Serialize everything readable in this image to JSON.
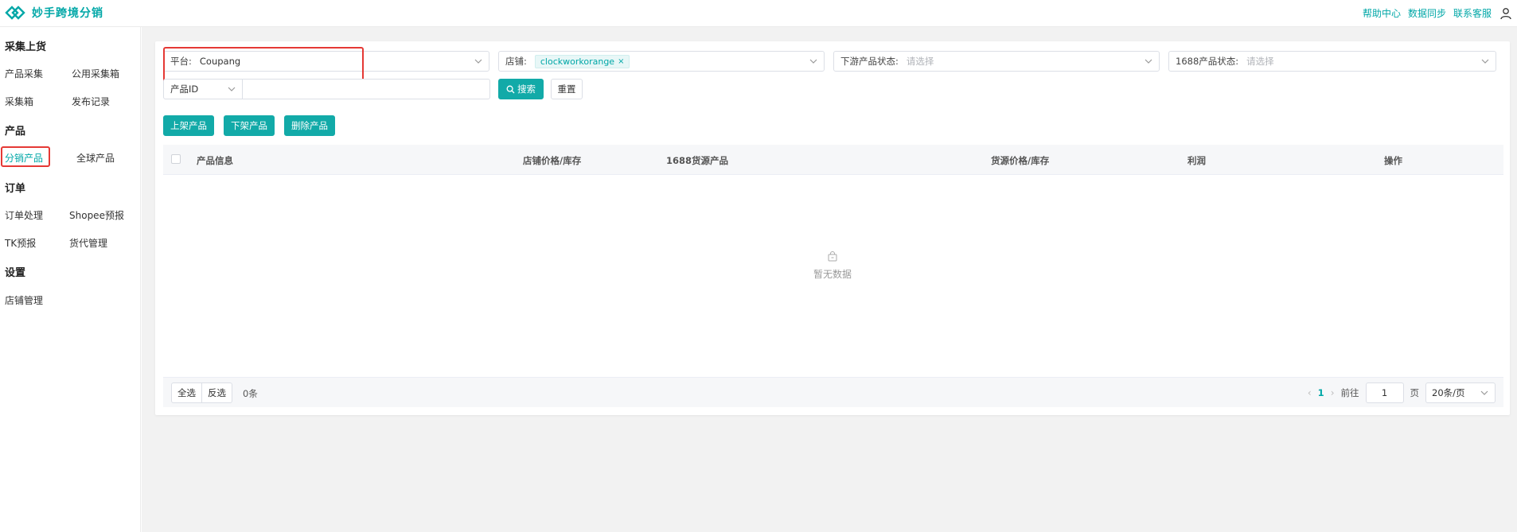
{
  "header": {
    "app_name": "妙手跨境分销",
    "links": [
      "帮助中心",
      "数据同步",
      "联系客服"
    ]
  },
  "sidebar": {
    "sections": [
      {
        "title": "采集上货",
        "items": [
          "产品采集",
          "公用采集箱",
          "采集箱",
          "发布记录"
        ]
      },
      {
        "title": "产品",
        "items": [
          "分销产品",
          "全球产品"
        ]
      },
      {
        "title": "订单",
        "items": [
          "订单处理",
          "Shopee预报",
          "TK预报",
          "货代管理"
        ]
      },
      {
        "title": "设置",
        "items": [
          "店铺管理"
        ]
      }
    ],
    "active_item": "分销产品"
  },
  "filters": {
    "platform": {
      "label": "平台:",
      "value": "Coupang"
    },
    "store": {
      "label": "店铺:",
      "tag": "clockworkorange",
      "tag_close": "×"
    },
    "downstream_status": {
      "label": "下游产品状态:",
      "placeholder": "请选择"
    },
    "status_1688": {
      "label": "1688产品状态:",
      "placeholder": "请选择"
    },
    "id_type": {
      "value": "产品ID"
    },
    "search_button": "搜索",
    "reset_button": "重置"
  },
  "actions": {
    "list": "上架产品",
    "delist": "下架产品",
    "delete": "删除产品"
  },
  "table": {
    "columns": [
      "产品信息",
      "店铺价格/库存",
      "1688货源产品",
      "货源价格/库存",
      "利润",
      "操作"
    ],
    "empty_text": "暂无数据"
  },
  "footer": {
    "select_all": "全选",
    "invert": "反选",
    "count": "0条",
    "current_page": "1",
    "goto_label": "前往",
    "goto_value": "1",
    "page_unit": "页",
    "page_size": "20条/页"
  },
  "colors": {
    "accent": "#12aaa8",
    "highlight_border": "#e53935"
  }
}
